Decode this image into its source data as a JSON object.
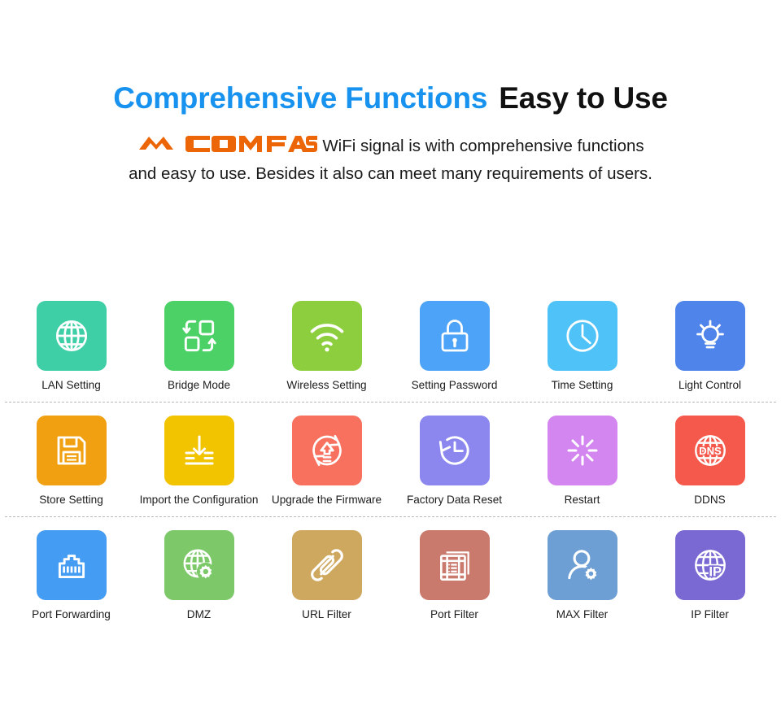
{
  "hero": {
    "title_accent": "Comprehensive Functions",
    "title_plain": "Easy to Use",
    "accent_color": "#1793ef",
    "brand_name": "COMFAST",
    "brand_color": "#ec6608",
    "subtitle_line1": "WiFi signal is with comprehensive functions",
    "subtitle_line2": "and easy to use. Besides it also can meet many requirements of users."
  },
  "grid": {
    "rows": [
      {
        "cells": [
          {
            "label": "LAN Setting",
            "icon": "globe-icon",
            "color": "#3ecfa6"
          },
          {
            "label": "Bridge Mode",
            "icon": "bridge-swap-icon",
            "color": "#4cd166"
          },
          {
            "label": "Wireless Setting",
            "icon": "wifi-icon",
            "color": "#8dce3e"
          },
          {
            "label": "Setting Password",
            "icon": "lock-icon",
            "color": "#4da3f7"
          },
          {
            "label": "Time Setting",
            "icon": "clock-icon",
            "color": "#4fc3f7"
          },
          {
            "label": "Light Control",
            "icon": "lightbulb-icon",
            "color": "#4f84ea"
          }
        ]
      },
      {
        "cells": [
          {
            "label": "Store Setting",
            "icon": "floppy-save-icon",
            "color": "#f0a010"
          },
          {
            "label": "Import the Configuration",
            "icon": "download-import-icon",
            "color": "#f2c川000"
          },
          {
            "label": "Upgrade the Firmware",
            "icon": "upgrade-refresh-icon",
            "color": "#f8705e"
          },
          {
            "label": "Factory Data Reset",
            "icon": "reset-clock-icon",
            "color": "#8b87ef"
          },
          {
            "label": "Restart",
            "icon": "restart-spinner-icon",
            "color": "#d385f0"
          },
          {
            "label": "DDNS",
            "icon": "dns-globe-icon",
            "color": "#f4594c"
          }
        ]
      },
      {
        "cells": [
          {
            "label": "Port Forwarding",
            "icon": "ethernet-port-icon",
            "color": "#449cf3"
          },
          {
            "label": "DMZ",
            "icon": "globe-gear-icon",
            "color": "#7dc96a"
          },
          {
            "label": "URL Filter",
            "icon": "link-chain-icon",
            "color": "#cfa860"
          },
          {
            "label": "Port Filter",
            "icon": "port-list-icon",
            "color": "#ca7a6c"
          },
          {
            "label": "MAX Filter",
            "icon": "user-gear-icon",
            "color": "#6d9ed4"
          },
          {
            "label": "IP Filter",
            "icon": "ip-globe-icon",
            "color": "#7a68d3"
          }
        ]
      }
    ]
  }
}
